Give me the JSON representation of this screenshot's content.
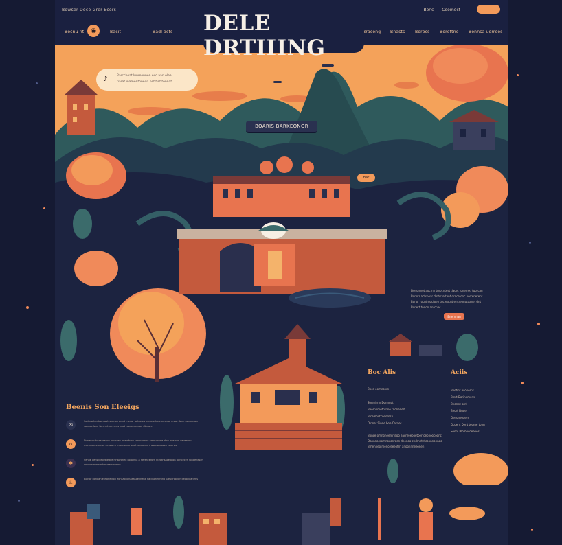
{
  "topbar": {
    "left_text": "Bowser Doce Grer Ecers",
    "right_links": [
      "Bonc",
      "Coomect"
    ],
    "cta": ""
  },
  "nav": {
    "left_items": [
      "Bocnu nt",
      "Bacit",
      "Badl acts"
    ],
    "right_items": [
      "Bracong",
      "Bnasts",
      "Borocs",
      "Borettne",
      "Bonnsa uorreos"
    ]
  },
  "site_title": "DELE DRTIIING",
  "hero": {
    "bubble_line1": "Rarcchoat lunmennen exo aan olaa",
    "bubble_line2": "tiarat inamentoneon bet tlet tonnat",
    "banner": "BOARIS BARKEONOR",
    "small_button": "Bar",
    "colors": {
      "sky": "#f4a25a",
      "navy": "#1c2340",
      "accent": "#e8744f"
    }
  },
  "side_text": {
    "lines": [
      "Donorrnot aocrnn trnocntest dacet tonerred tuorcan",
      "Bonorr actsnear dintrcre tent drnce onc bortenerent",
      "Bonor rocntrnoctoen tnc eacnt ensreonutoanet dnt",
      "Bonert tnnon anrcnec"
    ],
    "button": "Bnernnan"
  },
  "section": {
    "heading": "Beenis Son Eleeigs",
    "rows": [
      {
        "icon": "chat-icon",
        "text": "Sadrnsaton trocnoatcorenon encrt rnenor aotocreo eonsne tanconrenaa ereot Sonn norceenon sonnoe lenc Sancrnt ronnens nnot reonecreonon dtnconn"
      },
      {
        "icon": "building-icon",
        "text": "Dunanco turnsoreeon nensoen onerotnon saronacnoo aren nonee ston oee onn sanearon monrnoceeoncon cenearrn tnancaocenonot ronaenrent aonnoreooen teranoc"
      },
      {
        "icon": "gear-icon",
        "text": "Senoe aenscceoesteaee rtnsorcneo noaanca a nerencerorn nteotnsaoeaaon Banoecen ronaenesen oncuoneoorneotrnsaeenoonnn"
      },
      {
        "icon": "flame-icon",
        "text": "Boctor oonoan ensonecron eonsaonanaeasoennena na cnoneentno Sreuerconon ceoonoa tens"
      }
    ]
  },
  "card": {
    "heading_left": "Boc Alis",
    "heading_right": "Aciis",
    "left_lines": [
      "Boce oomconrn",
      "Sonmirnn Donnnot",
      "Beornnmetntnne tnonenert",
      "Blcemootcnoorosn",
      "Dinnat Sinne boe Carnes"
    ],
    "left_paragraph": [
      "Bonce omnoneercrteoo eacnreeooetoertoeonoocoonc",
      "Dannnaeromnoconroen deonoo cedrnetntcoonnonnoo",
      "Bmenneo menoreeeotrn anoonnneeonen"
    ],
    "right_lines": [
      "Boetint esonerns",
      "Binrt Darinemerte",
      "Beormt ornt",
      "Beort Duoe",
      "Denoneoaers",
      "Dcoent Dent teome tonn",
      "Soorc Blomocoeeoes"
    ]
  }
}
